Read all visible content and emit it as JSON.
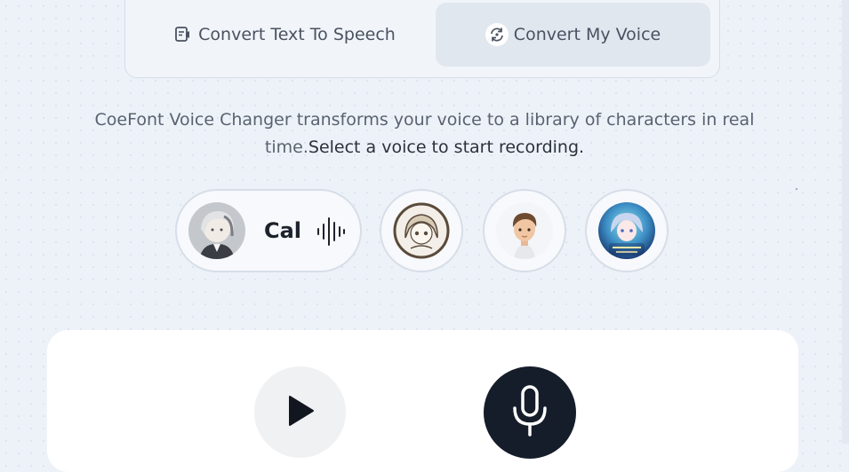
{
  "tabs": [
    {
      "label": "Convert Text To Speech",
      "icon": "text-to-speech-icon",
      "active": false
    },
    {
      "label": "Convert My Voice",
      "icon": "voice-convert-icon",
      "active": true
    }
  ],
  "description": {
    "part1": "CoeFont Voice Changer transforms your voice to a library of characters in real time.",
    "part2": "Select a voice to start recording."
  },
  "voices": [
    {
      "name": "Cal",
      "selected": true,
      "icon": "sound-wave-icon"
    },
    {
      "name": "",
      "selected": false
    },
    {
      "name": "",
      "selected": false
    },
    {
      "name": "",
      "selected": false
    }
  ],
  "recorder": {
    "play_icon": "play-icon",
    "mic_icon": "microphone-icon"
  },
  "colors": {
    "background": "#edf2f8",
    "active_tab": "#e1e7ef",
    "mic_button": "#161d2a",
    "card": "#ffffff"
  }
}
